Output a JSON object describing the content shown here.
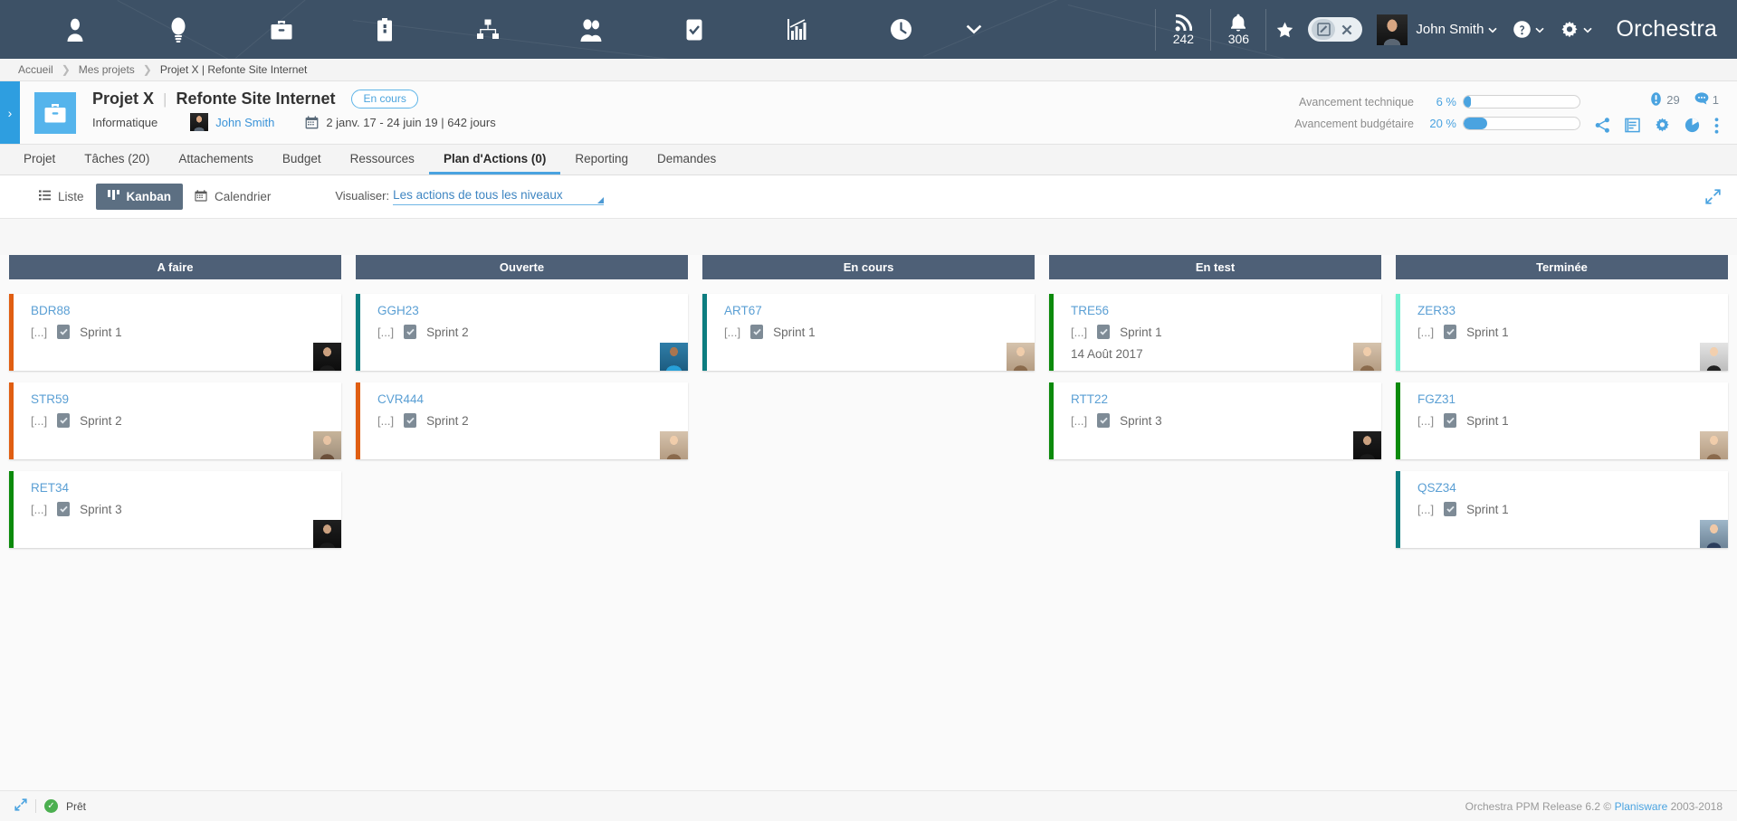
{
  "topnav": {
    "icons": [
      {
        "name": "user-icon",
        "label": "Utilisateur"
      },
      {
        "name": "idea-bulb-icon",
        "label": "Idées"
      },
      {
        "name": "briefcase-icon",
        "label": "Portefeuille"
      },
      {
        "name": "project-bag-icon",
        "label": "Projets"
      },
      {
        "name": "org-chart-icon",
        "label": "Organisation"
      },
      {
        "name": "people-icon",
        "label": "Ressources"
      },
      {
        "name": "checkbox-icon",
        "label": "Tâches"
      },
      {
        "name": "bar-chart-icon",
        "label": "Reporting"
      },
      {
        "name": "clock-icon",
        "label": "Temps"
      }
    ],
    "more_caret": "⌄",
    "feed_count": "242",
    "alert_count": "306",
    "user_name": "John Smith",
    "brand": "Orchestra",
    "brand_color": "#ffffff",
    "accent_color": "#4aa3e0"
  },
  "breadcrumb": {
    "items": [
      "Accueil",
      "Mes projets",
      "Projet X | Refonte Site Internet"
    ],
    "separator": "❯"
  },
  "project": {
    "name": "Projet X",
    "divider": "|",
    "subtitle": "Refonte Site Internet",
    "status_badge": "En cours",
    "department": "Informatique",
    "owner": "John Smith",
    "dates": "2 janv. 17 - 24 juin 19 | 642 jours",
    "technical_progress_label": "Avancement technique",
    "technical_progress_value": "6 %",
    "technical_progress_pct": 6,
    "budget_progress_label": "Avancement budgétaire",
    "budget_progress_value": "20 %",
    "budget_progress_pct": 20,
    "alerts_count": "29",
    "comments_count": "1"
  },
  "tabs": [
    {
      "label": "Projet",
      "active": false
    },
    {
      "label": "Tâches (20)",
      "active": false
    },
    {
      "label": "Attachements",
      "active": false
    },
    {
      "label": "Budget",
      "active": false
    },
    {
      "label": "Ressources",
      "active": false
    },
    {
      "label": "Plan d'Actions (0)",
      "active": true
    },
    {
      "label": "Reporting",
      "active": false
    },
    {
      "label": "Demandes",
      "active": false
    }
  ],
  "toolbar": {
    "views": [
      {
        "label": "Liste",
        "active": false
      },
      {
        "label": "Kanban",
        "active": true
      },
      {
        "label": "Calendrier",
        "active": false
      }
    ],
    "visualize_label": "Visualiser:",
    "visualize_value": "Les actions de tous les niveaux"
  },
  "board": {
    "columns": [
      {
        "title": "A faire",
        "cards": [
          {
            "id": "BDR88",
            "dots": "[...]",
            "sprint": "Sprint 1",
            "date": "",
            "accent": "#e05e12",
            "avatar": "av1"
          },
          {
            "id": "STR59",
            "dots": "[...]",
            "sprint": "Sprint 2",
            "date": "",
            "accent": "#e05e12",
            "avatar": "av2"
          },
          {
            "id": "RET34",
            "dots": "[...]",
            "sprint": "Sprint 3",
            "date": "",
            "accent": "#0b8a0b",
            "avatar": "av1"
          }
        ]
      },
      {
        "title": "Ouverte",
        "cards": [
          {
            "id": "GGH23",
            "dots": "[...]",
            "sprint": "Sprint 2",
            "date": "",
            "accent": "#0c7d80",
            "avatar": "av3"
          },
          {
            "id": "CVR444",
            "dots": "[...]",
            "sprint": "Sprint 2",
            "date": "",
            "accent": "#e05e12",
            "avatar": "av4"
          }
        ]
      },
      {
        "title": "En cours",
        "cards": [
          {
            "id": "ART67",
            "dots": "[...]",
            "sprint": "Sprint 1",
            "date": "",
            "accent": "#0c7d80",
            "avatar": "av4"
          }
        ]
      },
      {
        "title": "En test",
        "cards": [
          {
            "id": "TRE56",
            "dots": "[...]",
            "sprint": "Sprint 1",
            "date": "14 Août 2017",
            "accent": "#0b8a0b",
            "avatar": "av4"
          },
          {
            "id": "RTT22",
            "dots": "[...]",
            "sprint": "Sprint 3",
            "date": "",
            "accent": "#0b8a0b",
            "avatar": "av1"
          }
        ]
      },
      {
        "title": "Terminée",
        "cards": [
          {
            "id": "ZER33",
            "dots": "[...]",
            "sprint": "Sprint 1",
            "date": "",
            "accent": "#6ef0cf",
            "avatar": "av5"
          },
          {
            "id": "FGZ31",
            "dots": "[...]",
            "sprint": "Sprint 1",
            "date": "",
            "accent": "#0b8a0b",
            "avatar": "av4"
          },
          {
            "id": "QSZ34",
            "dots": "[...]",
            "sprint": "Sprint 1",
            "date": "",
            "accent": "#0c7d80",
            "avatar": "av6"
          }
        ]
      }
    ]
  },
  "footer": {
    "status": "Prêt",
    "copyright_pre": "Orchestra PPM Release 6.2 ©",
    "vendor": "Planisware",
    "years": "2003-2018"
  }
}
